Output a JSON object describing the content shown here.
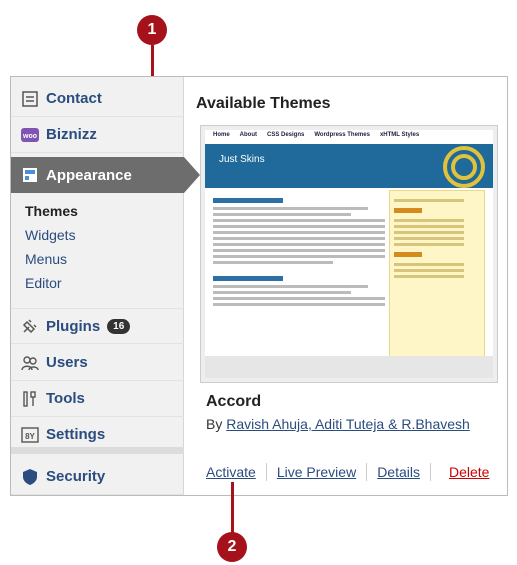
{
  "sidebar": {
    "contact": "Contact",
    "biznizz": "Biznizz",
    "appearance": "Appearance",
    "submenu": [
      "Themes",
      "Widgets",
      "Menus",
      "Editor"
    ],
    "plugins": "Plugins",
    "plugins_badge": "16",
    "users": "Users",
    "tools": "Tools",
    "settings": "Settings",
    "security": "Security"
  },
  "main": {
    "heading": "Available Themes",
    "preview": {
      "nav": [
        "Home",
        "About",
        "CSS Designs",
        "Wordpress Themes",
        "xHTML Styles"
      ],
      "site_title": "Just Skins"
    },
    "theme_title": "Accord",
    "by": "By",
    "authors": "Ravish Ahuja, Aditi Tuteja & R.Bhavesh",
    "actions": {
      "activate": "Activate",
      "live_preview": "Live Preview",
      "details": "Details",
      "delete": "Delete"
    }
  },
  "callouts": [
    "1",
    "2"
  ],
  "colors": {
    "callout": "#a5121b",
    "link": "#2b4c7e",
    "delete": "#cc0000",
    "active_menu": "#6d6d6d"
  }
}
